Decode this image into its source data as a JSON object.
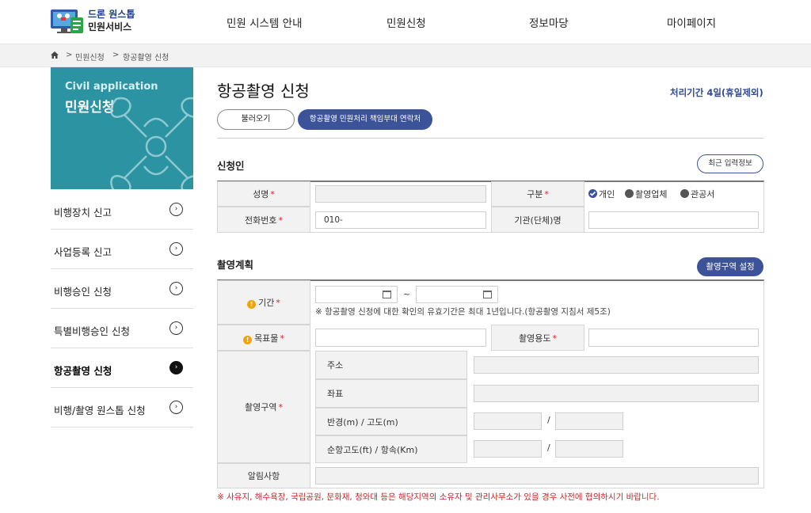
{
  "header": {
    "logo_line1": "드론 원스톱",
    "logo_line2": "민원서비스",
    "nav": [
      "민원 시스템 안내",
      "민원신청",
      "정보마당",
      "마이페이지"
    ]
  },
  "breadcrumb": {
    "items": [
      "민원신청",
      "항공촬영 신청"
    ]
  },
  "sidebar": {
    "banner_en": "Civil application",
    "banner_ko": "민원신청",
    "items": [
      {
        "label": "비행장치 신고"
      },
      {
        "label": "사업등록 신고"
      },
      {
        "label": "비행승인 신청"
      },
      {
        "label": "특별비행승인 신청"
      },
      {
        "label": "항공촬영 신청"
      },
      {
        "label": "비행/촬영 원스톱 신청"
      }
    ],
    "arrow_glyph": "›",
    "active_index": 4
  },
  "page": {
    "title": "항공촬영 신청",
    "period": "처리기간 4일(휴일제외)",
    "load_button": "불러오기",
    "contact_button": "항공촬영 민원처리 책임부대 연락처"
  },
  "applicant": {
    "section_title": "신청인",
    "recent_button": "최근 입력정보",
    "name_label": "성명",
    "name_value": "",
    "type_label": "구분",
    "type_options": [
      "개인",
      "촬영업체",
      "관공서"
    ],
    "type_selected": "개인",
    "phone_label": "전화번호",
    "phone_value": "010-",
    "org_label": "기관(단체)명",
    "org_value": ""
  },
  "plan": {
    "section_title": "촬영계획",
    "area_button": "촬영구역 설정",
    "period_label": "기간",
    "tilde": "~",
    "period_note": "※ 항공촬영 신청에 대한 확인의 유효기간은 최대 1년입니다.(항공촬영 지침서 제5조)",
    "target_label": "목표물",
    "purpose_label": "촬영용도",
    "area_label": "촬영구역",
    "address_label": "주소",
    "coord_label": "좌표",
    "radius_label": "반경(m) / 고도(m)",
    "cruise_label": "순항고도(ft) / 항속(Km)",
    "slash": "/",
    "notice_label": "알림사항",
    "required_mark": "*",
    "warn_mark": "!"
  },
  "footer_note": "※ 사유지, 해수욕장, 국립공원, 문화재, 청와대 등은 해당지역의 소유자 및 관리사무소가 있을 경우 사전에 협의하시기 바랍니다.",
  "colors": {
    "accent": "#3d5399",
    "banner": "#2c93a3",
    "required": "#d2232a",
    "warning": "#f0a30a"
  }
}
